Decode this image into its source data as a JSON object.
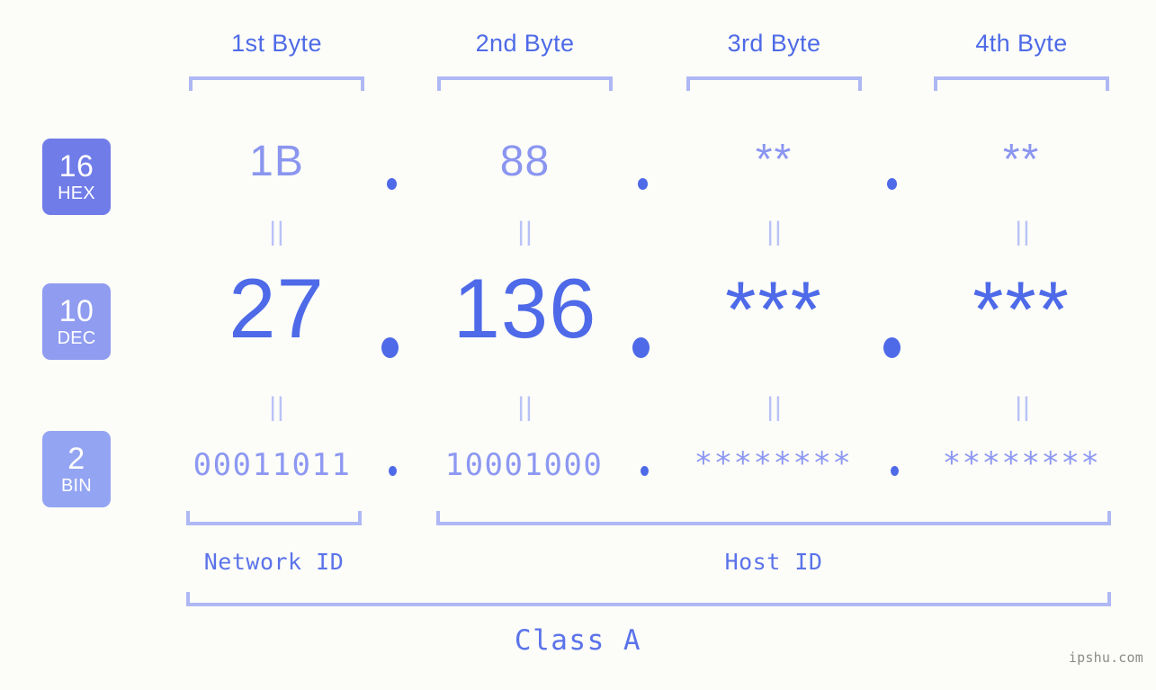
{
  "watermark": "ipshu.com",
  "class_label": "Class A",
  "bytes": [
    {
      "title": "1st Byte"
    },
    {
      "title": "2nd Byte"
    },
    {
      "title": "3rd Byte"
    },
    {
      "title": "4th Byte"
    }
  ],
  "rows": [
    {
      "base": "16",
      "base_name": "HEX",
      "badge_color": "#707ce8",
      "values": [
        "1B",
        "88",
        "**",
        "**"
      ],
      "separator": "."
    },
    {
      "base": "10",
      "base_name": "DEC",
      "badge_color": "#8f9cf0",
      "values": [
        "27",
        "136",
        "***",
        "***"
      ],
      "separator": "."
    },
    {
      "base": "2",
      "base_name": "BIN",
      "badge_color": "#93a5f2",
      "values": [
        "00011011",
        "10001000",
        "********",
        "********"
      ],
      "separator": "."
    }
  ],
  "equals_symbol": "||",
  "id_sections": [
    {
      "label": "Network ID"
    },
    {
      "label": "Host ID"
    }
  ],
  "colors": {
    "background": "#fcfdf8",
    "accent_strong": "#4e6ae8",
    "accent_light": "#8b96f0",
    "bracket": "#aeb8f5",
    "equals": "#b9c2f7",
    "watermark": "#8b8b8b"
  }
}
